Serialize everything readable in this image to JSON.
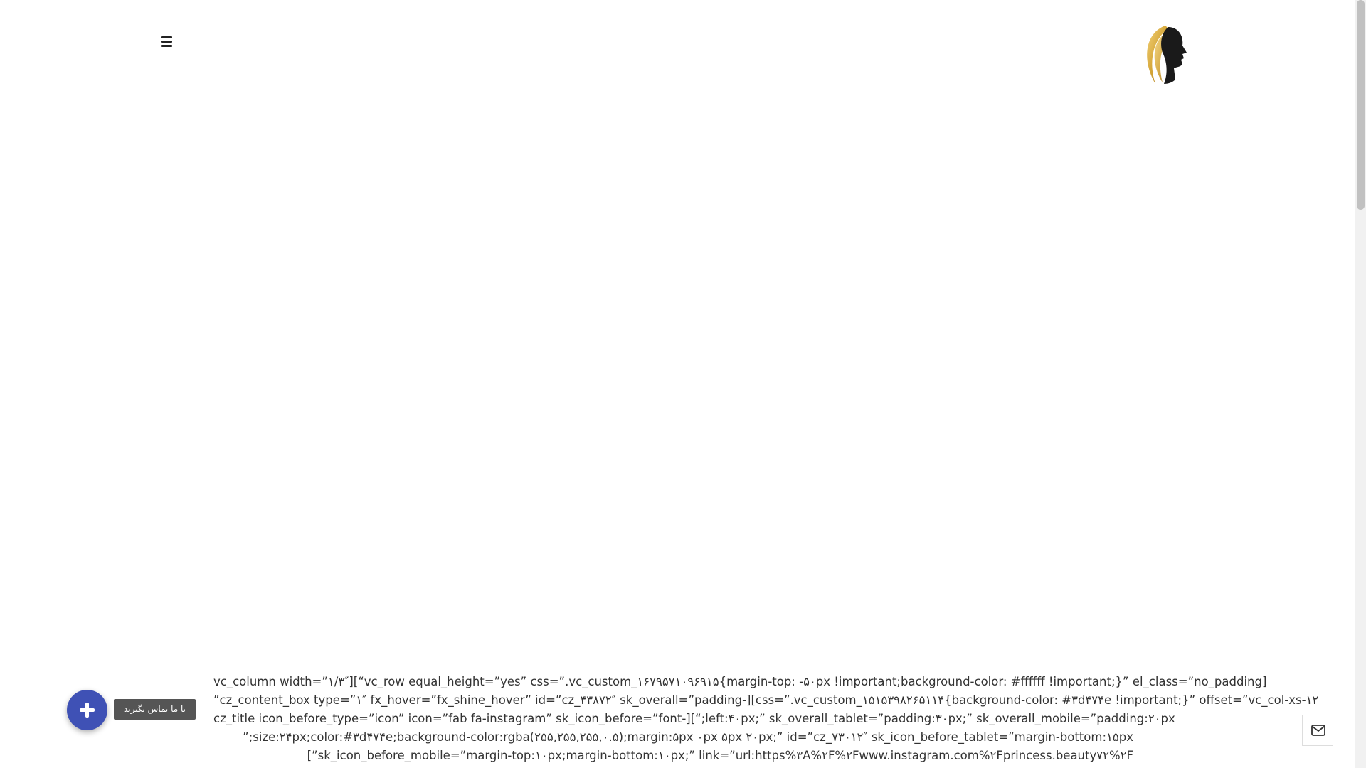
{
  "header": {
    "menu_icon": "hamburger-menu-icon",
    "logo_icon": "woman-silhouette-gold-hair-logo"
  },
  "content": {
    "shortcode_lines": [
      "vc_column width=”۱/۳″][“vc_row equal_height=”yes” css=”.vc_custom_۱۶۷۹۵۷۱۰۹۶۹۱۵{margin-top: -۵۰px !important;background-color: #ffffff !important;}” el_class=”no_padding]",
      "”cz_content_box type=”۱″ fx_hover=”fx_shine_hover” id=”cz_۴۳۸۷۲″ sk_overall=”padding-][css=”.vc_custom_۱۵۱۵۳۹۸۲۶۵۱۱۴{background-color: #۳d۴۷۴e !important;}” offset=”vc_col-xs-۱۲",
      "cz_title icon_before_type=”icon” icon=”fab fa-instagram” sk_icon_before=”font-][“;left:۴۰px;” sk_overall_tablet=”padding:۳۰px;” sk_overall_mobile=”padding:۲۰px",
      "”;size:۲۴px;color:#۳d۴۷۴e;background-color:rgba(۲۵۵,۲۵۵,۲۵۵,۰.۵);margin:۵px ۰px ۵px ۲۰px;” id=”cz_۷۳۰۱۲″ sk_icon_before_tablet=”margin-bottom:۱۵px",
      "[”sk_icon_before_mobile=”margin-top:۱۰px;margin-bottom:۱۰px;” link=”url:https%۳A%۲F%۲Fwww.instagram.com%۲Fprincess.beauty۷۲%۲F"
    ]
  },
  "floating": {
    "contact_label": "با ما تماس بگیرید",
    "add_icon": "plus-icon",
    "mail_icon": "envelope-icon"
  },
  "colors": {
    "fab": "#3f51b5",
    "label_bg": "#555555",
    "logo_gold": "#d4a537",
    "logo_dark": "#1a1a1a"
  }
}
